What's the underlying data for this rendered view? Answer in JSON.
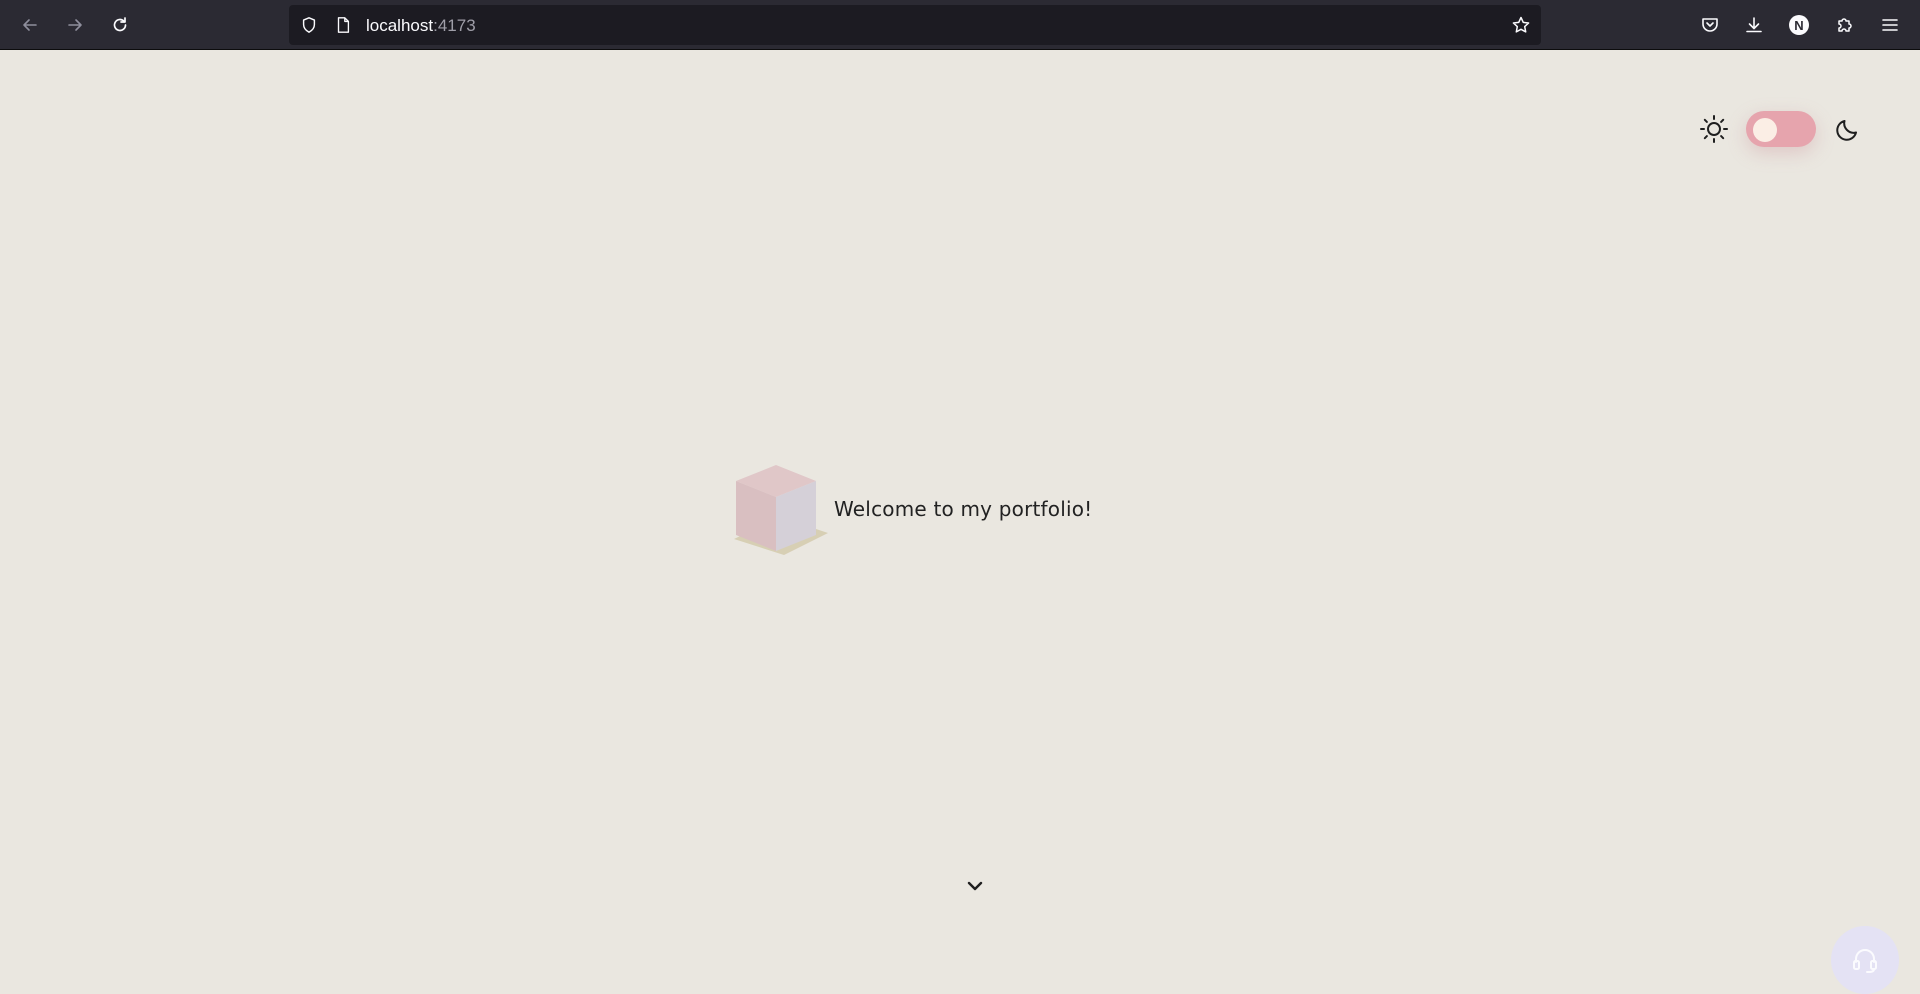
{
  "browser": {
    "url_host": "localhost",
    "url_port": ":4173",
    "profile_initial": "N",
    "icons": {
      "back": "arrow-left-icon",
      "forward": "arrow-right-icon",
      "reload": "reload-icon",
      "shield": "shield-icon",
      "page": "page-icon",
      "bookmark": "star-icon",
      "pocket": "pocket-icon",
      "downloads": "download-icon",
      "extensions": "puzzle-icon",
      "menu": "hamburger-menu-icon"
    }
  },
  "page": {
    "welcome_text": "Welcome to my portfolio!",
    "theme_toggle": {
      "state": "light",
      "sun_icon": "sun-icon",
      "moon_icon": "moon-icon"
    },
    "scroll_icon": "chevron-down-icon",
    "chat_icon": "headset-icon"
  },
  "colors": {
    "page_background": "#eae7e0",
    "toggle_track": "#e6a4ad",
    "toggle_knob": "#fbeee5",
    "chat_button": "#e4e2f4",
    "browser_chrome": "#2b2a33",
    "urlbar": "#1c1b22"
  }
}
